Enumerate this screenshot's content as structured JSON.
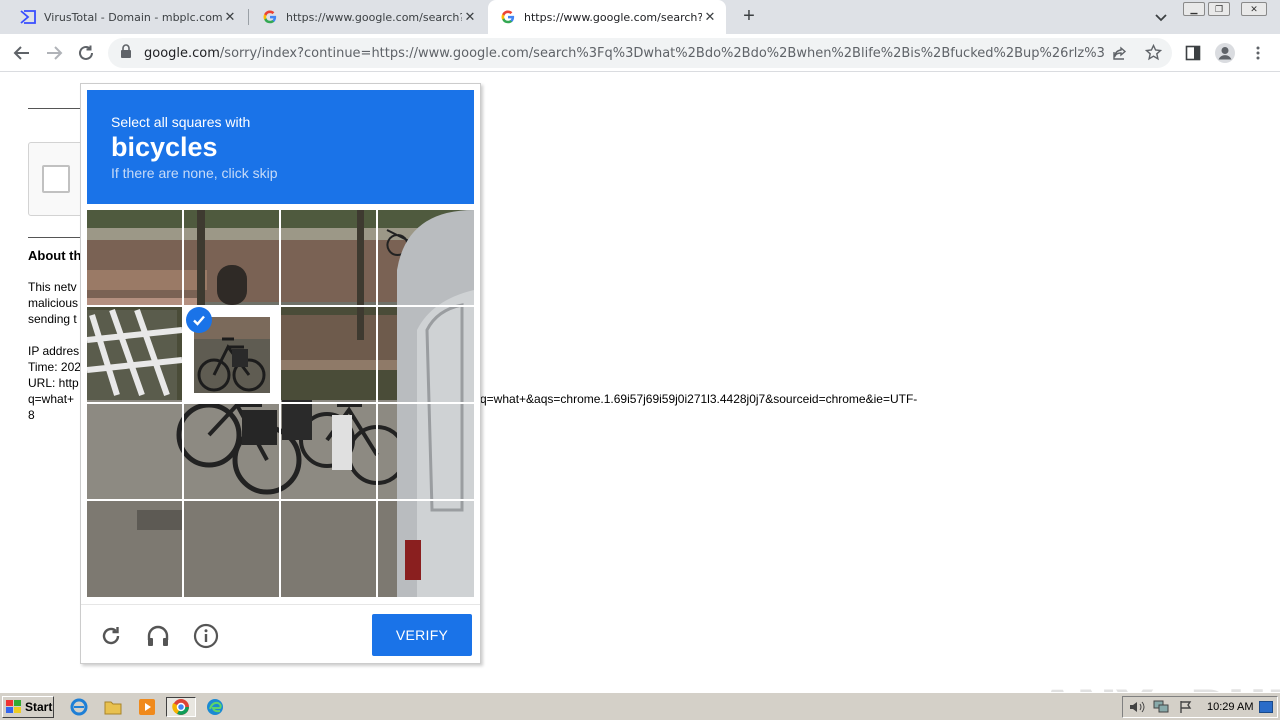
{
  "browser": {
    "tabs": [
      {
        "title": "VirusTotal - Domain - mbplc.com",
        "favicon": "virustotal-icon"
      },
      {
        "title": "https://www.google.com/search?q=",
        "favicon": "google-icon"
      },
      {
        "title": "https://www.google.com/search?q=",
        "favicon": "google-icon",
        "active": true
      }
    ],
    "close_glyph": "✕",
    "new_tab_glyph": "+",
    "omnibox": {
      "host": "google.com",
      "path": "/sorry/index?continue=https://www.google.com/search%3Fq%3Dwhat%2Bdo%2Bdo%2Bwhen%2Blife%2Bis%2Bfucked%2Bup%26rlz%3D..."
    }
  },
  "page": {
    "about_heading": "About th",
    "paragraph_lines": [
      "This netv",
      "malicious",
      "sending t"
    ],
    "ip_line": "IP addres",
    "time_line": "Time: 202",
    "url_line": "URL: http",
    "url_line2": "q=what+",
    "url_line3": "8",
    "url_continuation": "q=what+&aqs=chrome.1.69i57j69i59j0i271l3.4428j0j7&sourceid=chrome&ie=UTF-"
  },
  "captcha": {
    "instruction": "Select all squares with",
    "target": "bicycles",
    "hint": "If there are none, click skip",
    "verify_label": "VERIFY",
    "selected_tiles": [
      5
    ],
    "colors": {
      "accent": "#1a73e8"
    }
  },
  "watermark": "ANY▷RUN",
  "taskbar": {
    "start_label": "Start",
    "clock": "10:29 AM"
  }
}
